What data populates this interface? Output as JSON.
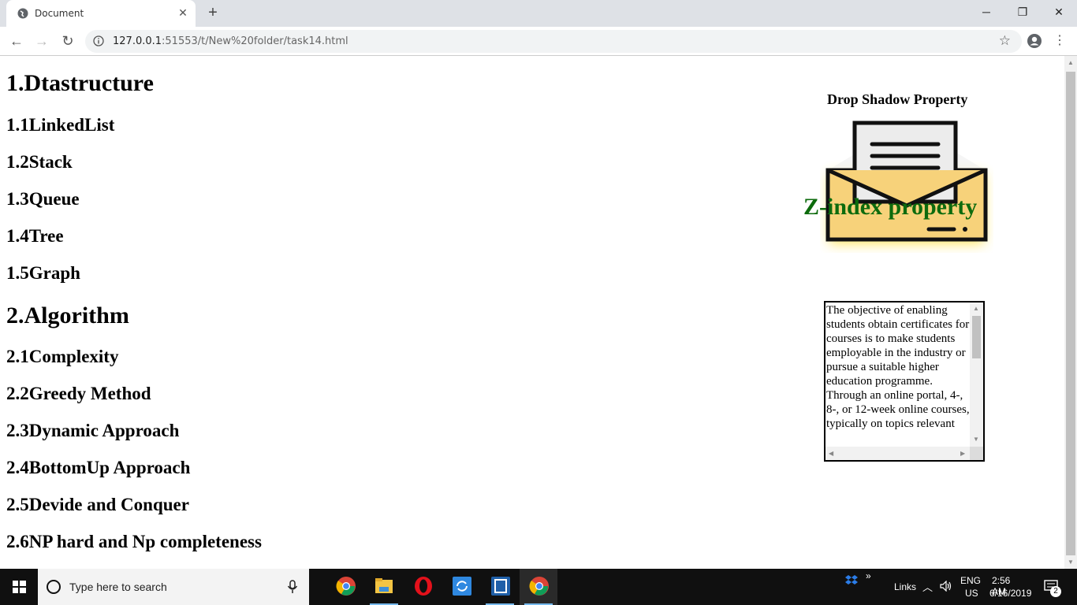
{
  "browser": {
    "tab_title": "Document",
    "url_host": "127.0.0.1",
    "url_rest": ":51553/t/New%20folder/task14.html",
    "window_controls": {
      "minimize": "─",
      "restore": "❐",
      "close": "✕"
    }
  },
  "page": {
    "headings": [
      {
        "level": 1,
        "text": "1.Dtastructure"
      },
      {
        "level": 2,
        "text": "1.1LinkedList"
      },
      {
        "level": 2,
        "text": "1.2Stack"
      },
      {
        "level": 2,
        "text": "1.3Queue"
      },
      {
        "level": 2,
        "text": "1.4Tree"
      },
      {
        "level": 2,
        "text": "1.5Graph"
      },
      {
        "level": 1,
        "text": "2.Algorithm"
      },
      {
        "level": 2,
        "text": "2.1Complexity"
      },
      {
        "level": 2,
        "text": "2.2Greedy Method"
      },
      {
        "level": 2,
        "text": "2.3Dynamic Approach"
      },
      {
        "level": 2,
        "text": "2.4BottomUp Approach"
      },
      {
        "level": 2,
        "text": "2.5Devide and Conquer"
      },
      {
        "level": 2,
        "text": "2.6NP hard and Np completeness"
      }
    ],
    "shadow_title": "Drop Shadow Property",
    "zindex_label": "Z-index property",
    "scroll_text": "The objective of enabling students obtain certificates for courses is to make students employable in the industry or pursue a suitable higher education programme. Through an online portal, 4-, 8-, or 12-week online courses, typically on topics relevant",
    "colors": {
      "zindex": "#0d6b0d",
      "envelope_fill": "#f7d27a",
      "envelope_glow": "#ffe14a"
    }
  },
  "taskbar": {
    "search_placeholder": "Type here to search",
    "links_label": "Links",
    "lang": "ENG",
    "region": "US",
    "time": "2:56 AM",
    "date": "6/16/2019",
    "notif_count": "2"
  }
}
